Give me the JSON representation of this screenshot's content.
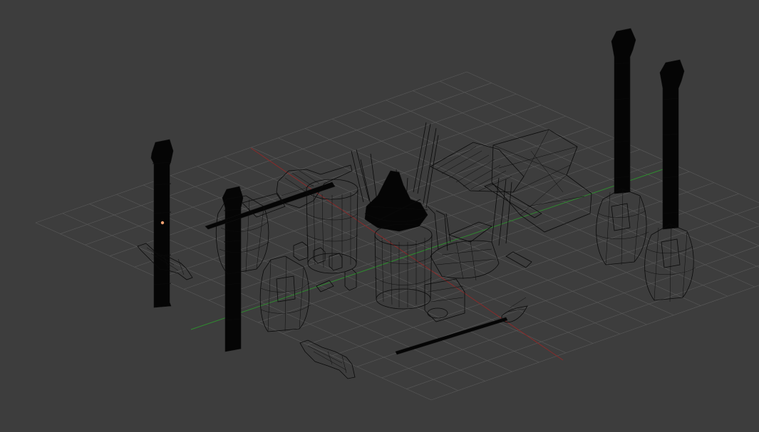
{
  "viewport": {
    "background": "#3d3d3d",
    "grid_color": "#5a5a5a",
    "x_axis_color": "#8a2a2a",
    "y_axis_color": "#2f8a2f",
    "wire_color": "#0a0a0a",
    "selected_origin_color": "#f0a070"
  },
  "scene": {
    "view_mode": "wireframe",
    "objects": [
      "left-pillar",
      "center-pillar",
      "right-pillar-back",
      "right-pillar-front",
      "left-pod",
      "center-pod",
      "right-pod-back",
      "right-pod-front",
      "turret-cylinder-left",
      "turret-cylinder-center",
      "central-spire-cluster",
      "antenna-arm-right",
      "crane-platform",
      "scaffold-box",
      "spear-staff",
      "debris-small-left",
      "debris-small-bottom"
    ]
  }
}
